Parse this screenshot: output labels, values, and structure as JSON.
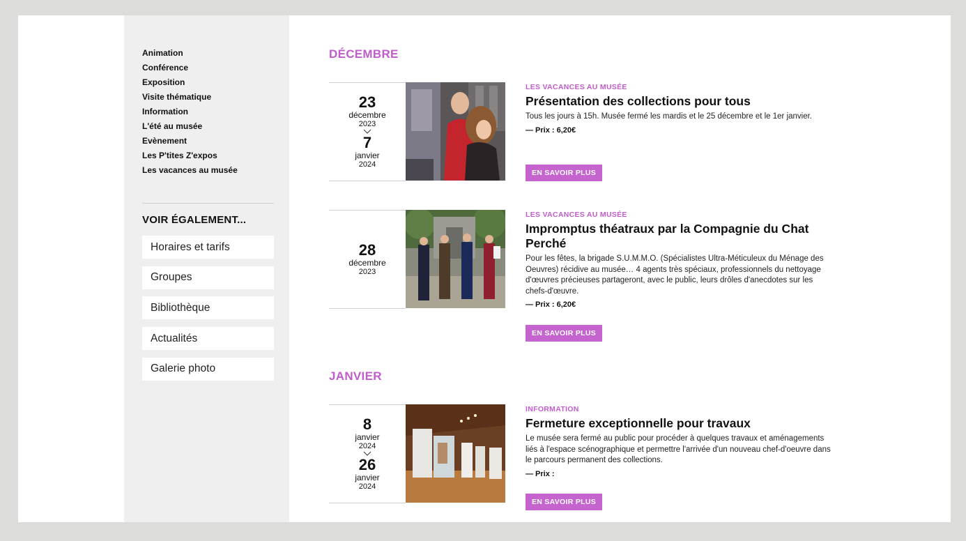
{
  "sidebar": {
    "categories": [
      "Animation",
      "Conférence",
      "Exposition",
      "Visite thématique",
      "Information",
      "L'été au musée",
      "Evènement",
      "Les P'tites Z'expos",
      "Les vacances au musée"
    ],
    "see_also_title": "VOIR ÉGALEMENT...",
    "links": [
      "Horaires et tarifs",
      "Groupes",
      "Bibliothèque",
      "Actualités",
      "Galerie photo"
    ]
  },
  "months": [
    "DÉCEMBRE",
    "JANVIER"
  ],
  "events": [
    {
      "start_day": "23",
      "start_month": "décembre",
      "start_year": "2023",
      "end_day": "7",
      "end_month": "janvier",
      "end_year": "2024",
      "tag": "LES VACANCES AU MUSÉE",
      "title": "Présentation des collections pour tous",
      "description": "Tous les jours à 15h. Musée fermé les mardis et le 25 décembre et le 1er janvier.",
      "price": "— Prix : 6,20€",
      "button": "EN SAVOIR PLUS"
    },
    {
      "start_day": "28",
      "start_month": "décembre",
      "start_year": "2023",
      "tag": "LES VACANCES AU MUSÉE",
      "title": "Impromptus théatraux par la Compagnie du Chat Perché",
      "description": "Pour les fêtes, la brigade S.U.M.M.O. (Spécialistes Ultra-Méticuleux du Ménage des Oeuvres) récidive au musée… 4 agents très spéciaux, professionnels du nettoyage d'œuvres précieuses partageront, avec le public, leurs drôles d'anecdotes sur les chefs-d'œuvre.",
      "price": "— Prix : 6,20€",
      "button": "EN SAVOIR PLUS"
    },
    {
      "start_day": "8",
      "start_month": "janvier",
      "start_year": "2024",
      "end_day": "26",
      "end_month": "janvier",
      "end_year": "2024",
      "tag": "INFORMATION",
      "title": "Fermeture exceptionnelle pour travaux",
      "description": "Le musée sera fermé au public pour procéder à quelques travaux et aménagements liés à l'espace scénographique et permettre l'arrivée d'un nouveau chef-d'oeuvre dans le parcours permanent des collections.",
      "price": "— Prix :",
      "button": "EN SAVOIR PLUS"
    }
  ],
  "colors": {
    "accent": "#c05ccc",
    "button": "#c564cf",
    "sidebar_bg": "#efefef",
    "page_bg": "#dcdcda"
  }
}
